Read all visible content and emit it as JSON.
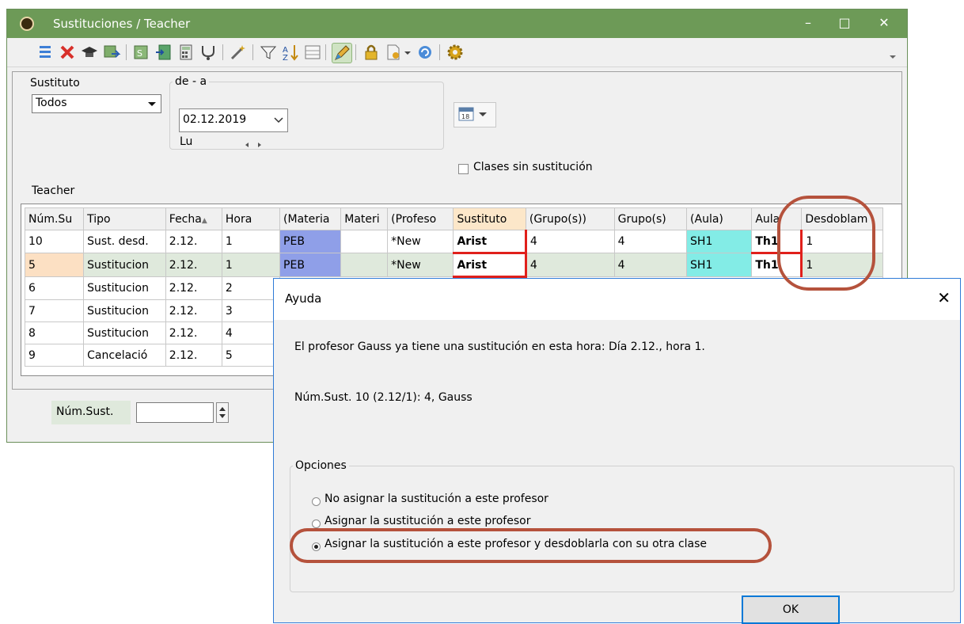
{
  "window": {
    "title": "Sustituciones / Teacher",
    "minimize": "–",
    "maximize": "□",
    "close": "✕"
  },
  "toolbar": {
    "icons": [
      "list-icon",
      "delete-icon",
      "graduation-cap-icon",
      "transfer-icon",
      "substitute-icon",
      "import-icon",
      "calculator-icon",
      "stethoscope-icon",
      "wand-icon",
      "filter-icon",
      "sort-icon",
      "grid-icon",
      "pencil-icon",
      "lock-icon",
      "document-settings-icon",
      "refresh-icon",
      "gear-icon"
    ]
  },
  "filters": {
    "sustituto_label": "Sustituto",
    "sustituto_value": "Todos",
    "range_label": "de - a",
    "date_value": "02.12.2019",
    "day_label": "Lu",
    "sin_sustitucion_label": "Clases sin sustitución",
    "teacher_label": "Teacher"
  },
  "grid": {
    "columns": [
      "Núm.Su",
      "Tipo",
      "Fecha",
      "Hora",
      "(Materia",
      "Materi",
      "(Profeso",
      "Sustituto",
      "(Grupo(s))",
      "Grupo(s)",
      "(Aula)",
      "Aula",
      "Desdoblam"
    ],
    "rows": [
      [
        "10",
        "Sust. desd.",
        "2.12.",
        "1",
        "PEB",
        "",
        "*New",
        "Arist",
        "4",
        "4",
        "SH1",
        "Th1",
        "1"
      ],
      [
        "5",
        "Sustitucion",
        "2.12.",
        "1",
        "PEB",
        "",
        "*New",
        "Arist",
        "4",
        "4",
        "SH1",
        "Th1",
        "1"
      ],
      [
        "6",
        "Sustitucion",
        "2.12.",
        "2",
        "",
        "",
        "",
        "",
        "",
        "",
        "",
        "",
        ""
      ],
      [
        "7",
        "Sustitucion",
        "2.12.",
        "3",
        "",
        "",
        "",
        "",
        "",
        "",
        "",
        "",
        ""
      ],
      [
        "8",
        "Sustitucion",
        "2.12.",
        "4",
        "",
        "",
        "",
        "",
        "",
        "",
        "",
        "",
        ""
      ],
      [
        "9",
        "Cancelació",
        "2.12.",
        "5",
        "",
        "",
        "",
        "",
        "",
        "",
        "",
        "",
        ""
      ]
    ]
  },
  "footer": {
    "num_sust_label": "Núm.Sust.",
    "num_sust_value": ""
  },
  "dialog": {
    "title": "Ayuda",
    "close": "✕",
    "message": "El profesor Gauss ya tiene una sustitución en esta hora: Día 2.12., hora 1.",
    "detail": "Núm.Sust. 10 (2.12/1): 4, Gauss",
    "options_legend": "Opciones",
    "option1": "No asignar la sustitución a este profesor",
    "option2": "Asignar la sustitución a este profesor",
    "option3": "Asignar la sustitución a este profesor y desdoblarla con su otra clase",
    "selected_option": 3,
    "ok_label": "OK"
  },
  "colors": {
    "titlebar": "#6d9a57",
    "materia_cell": "#8f9fe8",
    "aula_cell": "#83ece6",
    "highlight_row": "#dfe9dc",
    "sustituto_header": "#fce7c9",
    "annotation_ring": "#b5523c",
    "conflict_line": "#e0201b"
  }
}
